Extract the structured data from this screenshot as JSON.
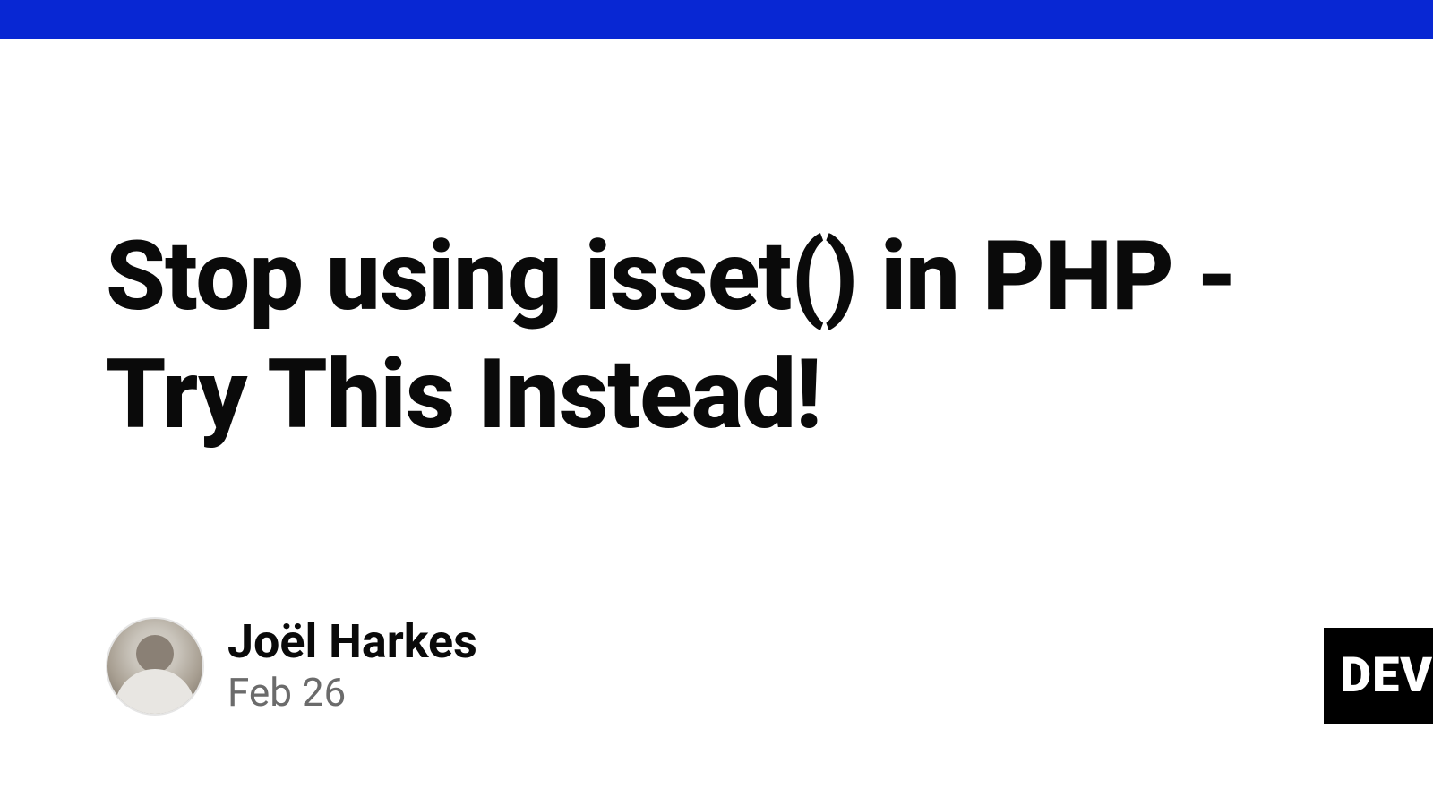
{
  "title": "Stop using isset() in PHP - Try This Instead!",
  "author": {
    "name": "Joël Harkes",
    "date": "Feb 26"
  },
  "badge": "DEV",
  "colors": {
    "topbar": "#0827d3"
  }
}
